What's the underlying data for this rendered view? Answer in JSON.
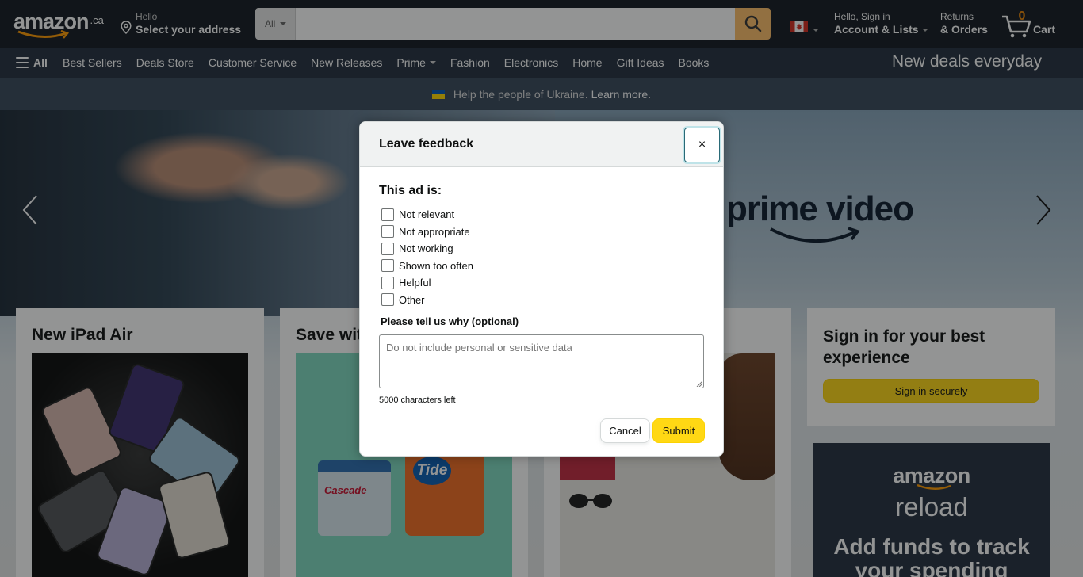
{
  "header": {
    "logo_text": "amazon",
    "logo_tld": ".ca",
    "address_hello": "Hello",
    "address_label": "Select your address",
    "search_category": "All",
    "search_value": "",
    "account_hello": "Hello, Sign in",
    "account_label": "Account & Lists",
    "returns_line1": "Returns",
    "returns_line2": "& Orders",
    "cart_count": "0",
    "cart_label": "Cart",
    "accent_color": "#febd69"
  },
  "nav": {
    "all_label": "All",
    "links": [
      "Best Sellers",
      "Deals Store",
      "Customer Service",
      "New Releases",
      "Prime",
      "Fashion",
      "Electronics",
      "Home",
      "Gift Ideas",
      "Books"
    ],
    "promo": "New deals everyday"
  },
  "banner": {
    "text": "Help the people of Ukraine.",
    "link": "Learn more."
  },
  "hero": {
    "brand_text": "prime video"
  },
  "cards": {
    "ipad_title": "New iPad Air",
    "save_title": "Save wit",
    "signin_title": "Sign in for your best experience",
    "signin_button": "Sign in securely",
    "cascade_label": "Cascade",
    "tide_label": "Tide",
    "reload_brand": "amazon",
    "reload_word": "reload",
    "reload_tagline": "Add funds to track your spending"
  },
  "modal": {
    "title": "Leave feedback",
    "close_label": "×",
    "question": "This ad is:",
    "options": [
      "Not relevant",
      "Not appropriate",
      "Not working",
      "Shown too often",
      "Helpful",
      "Other"
    ],
    "why_label": "Please tell us why (optional)",
    "why_placeholder": "Do not include personal or sensitive data",
    "chars_left": "5000 characters left",
    "cancel_label": "Cancel",
    "submit_label": "Submit"
  }
}
